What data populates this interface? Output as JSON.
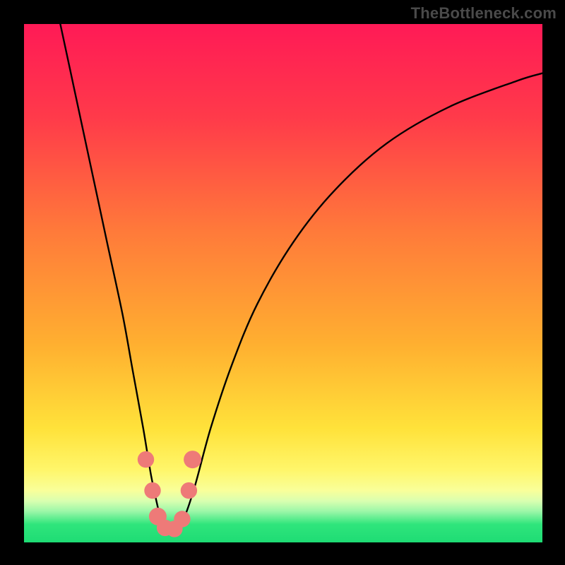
{
  "attribution": {
    "label": "TheBottleneck.com"
  },
  "colors": {
    "frame": "#000000",
    "curve": "#000000",
    "marker": "#ee7a78",
    "gradient_stops": [
      {
        "pct": 0,
        "color": "#ff1a56"
      },
      {
        "pct": 18,
        "color": "#ff3a4a"
      },
      {
        "pct": 40,
        "color": "#ff7a3a"
      },
      {
        "pct": 62,
        "color": "#ffb030"
      },
      {
        "pct": 78,
        "color": "#ffe23a"
      },
      {
        "pct": 86,
        "color": "#fff66a"
      },
      {
        "pct": 90,
        "color": "#f9ff9a"
      },
      {
        "pct": 92,
        "color": "#d9ffb0"
      },
      {
        "pct": 94,
        "color": "#9cf7a8"
      },
      {
        "pct": 96.5,
        "color": "#2fe57c"
      },
      {
        "pct": 100,
        "color": "#1edc74"
      }
    ]
  },
  "chart_data": {
    "type": "line",
    "title": "",
    "xlabel": "",
    "ylabel": "",
    "xlim": [
      0,
      100
    ],
    "ylim": [
      0,
      100
    ],
    "grid": false,
    "legend": false,
    "series": [
      {
        "name": "bottleneck-curve",
        "x": [
          7,
          10,
          13,
          16,
          19,
          21,
          23,
          24.5,
          26,
          27,
          28,
          29.5,
          31,
          33,
          36,
          40,
          45,
          52,
          60,
          70,
          82,
          95,
          100
        ],
        "y": [
          100,
          86,
          72,
          58,
          44,
          33,
          22,
          13,
          6,
          2.5,
          2,
          2.5,
          5,
          11,
          22,
          34,
          46,
          58,
          68,
          77,
          84,
          89,
          90.5
        ]
      }
    ],
    "markers": [
      {
        "x": 23.5,
        "y": 16,
        "r": 1.6
      },
      {
        "x": 24.8,
        "y": 10,
        "r": 1.6
      },
      {
        "x": 25.8,
        "y": 5,
        "r": 1.7
      },
      {
        "x": 27.2,
        "y": 2.8,
        "r": 1.6
      },
      {
        "x": 29.0,
        "y": 2.6,
        "r": 1.6
      },
      {
        "x": 30.5,
        "y": 4.5,
        "r": 1.6
      },
      {
        "x": 31.8,
        "y": 10,
        "r": 1.6
      },
      {
        "x": 32.5,
        "y": 16,
        "r": 1.7
      }
    ]
  }
}
